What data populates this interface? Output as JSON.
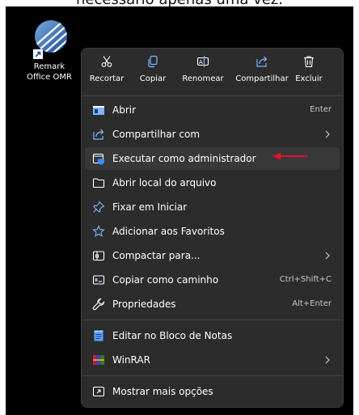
{
  "caption": "necessário apenas uma vez.",
  "desktop": {
    "icon_label_line1": "Remark",
    "icon_label_line2": "Office OMR"
  },
  "toolbar": [
    {
      "label": "Recortar",
      "icon": "scissors-icon"
    },
    {
      "label": "Copiar",
      "icon": "copy-icon"
    },
    {
      "label": "Renomear",
      "icon": "rename-icon"
    },
    {
      "label": "Compartilhar",
      "icon": "share-icon"
    },
    {
      "label": "Excluir",
      "icon": "trash-icon"
    }
  ],
  "menu": {
    "items": [
      {
        "label": "Abrir",
        "shortcut": "Enter",
        "icon": "app-window-icon"
      },
      {
        "label": "Compartilhar com",
        "icon": "share-icon"
      },
      {
        "label": "Executar como administrador",
        "icon": "shield-admin-icon"
      },
      {
        "label": "Abrir local do arquivo",
        "icon": "folder-icon"
      },
      {
        "label": "Fixar em Iniciar",
        "icon": "pin-icon"
      },
      {
        "label": "Adicionar aos Favoritos",
        "icon": "star-icon"
      },
      {
        "label": "Compactar para...",
        "icon": "archive-icon"
      },
      {
        "label": "Copiar como caminho",
        "shortcut": "Ctrl+Shift+C",
        "icon": "path-icon"
      },
      {
        "label": "Propriedades",
        "shortcut": "Alt+Enter",
        "icon": "wrench-icon"
      },
      {
        "label": "Editar no Bloco de Notas",
        "icon": "notepad-icon"
      },
      {
        "label": "WinRAR",
        "icon": "winrar-icon"
      },
      {
        "label": "Mostrar mais opções",
        "icon": "more-options-icon"
      }
    ]
  },
  "colors": {
    "menu_bg": "#2c2c2c",
    "highlight": "#383838",
    "icon_blue": "#7fb6ff",
    "annotation_red": "#e81123"
  }
}
